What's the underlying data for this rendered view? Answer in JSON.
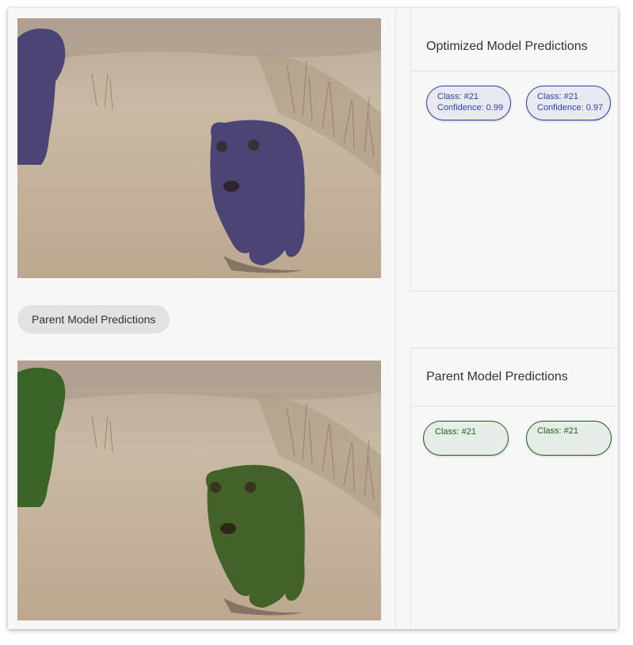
{
  "colors": {
    "optimized_mask": "#3b3f9e",
    "parent_mask": "#2a7a1f",
    "optimized_chip_border": "#2e3fb0",
    "parent_chip_border": "#1e5e1e"
  },
  "images": {
    "optimized": {
      "subject": "bear-photo",
      "mask_color": "#3b3f9e"
    },
    "parent": {
      "subject": "bear-photo",
      "mask_color": "#2a7a1f"
    }
  },
  "parent_toggle_label": "Parent Model Predictions",
  "optimized_panel": {
    "title": "Optimized Model Predictions",
    "predictions": [
      {
        "class_label": "Class: #21",
        "confidence_label": "Confidence: 0.99"
      },
      {
        "class_label": "Class: #21",
        "confidence_label": "Confidence: 0.97"
      }
    ]
  },
  "parent_panel": {
    "title": "Parent Model Predictions",
    "predictions": [
      {
        "class_label": "Class: #21"
      },
      {
        "class_label": "Class: #21"
      }
    ]
  }
}
